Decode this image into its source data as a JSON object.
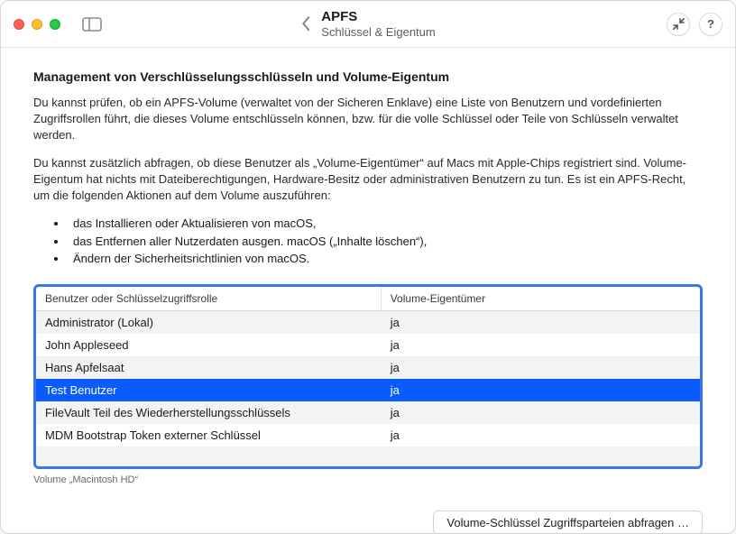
{
  "titlebar": {
    "title": "APFS",
    "subtitle": "Schlüssel & Eigentum"
  },
  "main": {
    "heading": "Management von Verschlüsselungsschlüsseln und Volume-Eigentum",
    "para1": "Du kannst prüfen, ob ein APFS-Volume (verwaltet von der Sicheren Enklave) eine Liste von Benutzern und vordefinierten Zugriffsrollen führt, die dieses Volume entschlüsseln können, bzw. für die volle Schlüssel oder Teile von Schlüsseln verwaltet werden.",
    "para2": "Du kannst zusätzlich abfragen, ob diese Benutzer als „Volume-Eigentümer“ auf Macs mit Apple-Chips registriert sind. Volume-Eigentum hat nichts mit Dateiberechtigungen, Hardware-Besitz oder administrativen Benutzern zu tun. Es ist ein APFS-Recht, um die folgenden Aktionen auf dem Volume auszuführen:",
    "bullets": [
      "das Installieren oder Aktualisieren von macOS,",
      "das Entfernen aller Nutzerdaten ausgen. macOS („Inhalte löschen“),",
      "Ändern der Sicherheitsrichtlinien von macOS."
    ]
  },
  "table": {
    "columns": {
      "user": "Benutzer oder Schlüsselzugriffsrolle",
      "owner": "Volume-Eigentümer"
    },
    "rows": [
      {
        "user": "Administrator (Lokal)",
        "owner": "ja",
        "selected": false
      },
      {
        "user": "John Appleseed",
        "owner": "ja",
        "selected": false
      },
      {
        "user": "Hans Apfelsaat",
        "owner": "ja",
        "selected": false
      },
      {
        "user": "Test Benutzer",
        "owner": "ja",
        "selected": true
      },
      {
        "user": "FileVault Teil des Wiederherstellungsschlüssels",
        "owner": "ja",
        "selected": false
      },
      {
        "user": "MDM Bootstrap Token externer Schlüssel",
        "owner": "ja",
        "selected": false
      }
    ],
    "caption": "Volume „Macintosh HD“"
  },
  "footer": {
    "query_button": "Volume-Schlüssel Zugriffsparteien abfragen …"
  }
}
